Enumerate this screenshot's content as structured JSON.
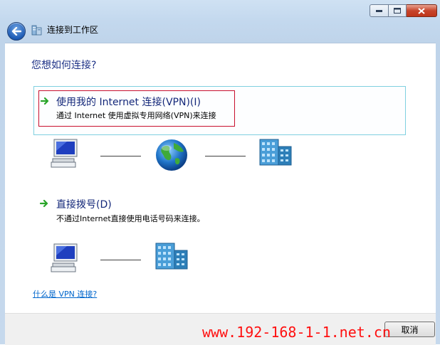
{
  "window": {
    "title": "连接到工作区"
  },
  "main": {
    "heading": "您想如何连接?",
    "options": [
      {
        "title": "使用我的 Internet 连接(VPN)(I)",
        "description": "通过 Internet 使用虚拟专用网络(VPN)来连接"
      },
      {
        "title": "直接拨号(D)",
        "description": "不通过Internet直接使用电话号码来连接。"
      }
    ],
    "help_link": "什么是 VPN 连接?"
  },
  "footer": {
    "cancel_label": "取消"
  },
  "watermark": "www.192-168-1-1.net.cn",
  "colors": {
    "heading": "#1e3287",
    "link": "#0066cc",
    "highlight_border": "#c8102e",
    "option_border": "#7fd0e0",
    "arrow": "#2aa52a",
    "watermark": "#ff1010"
  }
}
